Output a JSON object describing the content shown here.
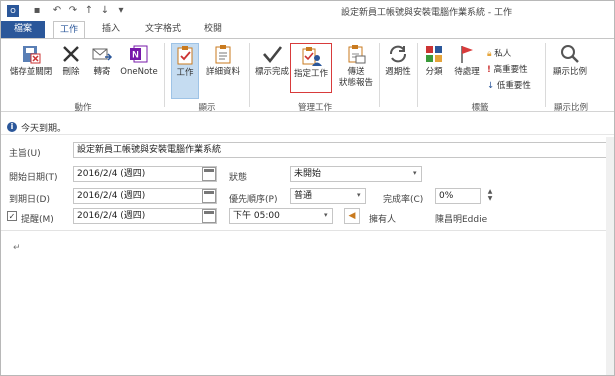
{
  "window": {
    "title": "設定新員工帳號與安裝電腦作業系統 - 工作"
  },
  "quick_access": {
    "save": "save-icon",
    "undo": "undo-icon",
    "redo": "redo-icon",
    "up": "arrow-up-icon",
    "down": "arrow-down-icon"
  },
  "tabs": [
    {
      "label": "檔案"
    },
    {
      "label": "工作"
    },
    {
      "label": "插入"
    },
    {
      "label": "文字格式"
    },
    {
      "label": "校閱"
    }
  ],
  "ribbon": {
    "groups": {
      "actions": "動作",
      "show": "顯示",
      "manage": "管理工作",
      "recurrence": "",
      "tags": "標籤",
      "zoom": "顯示比例"
    },
    "buttons": {
      "save_close": "儲存並關閉",
      "delete": "刪除",
      "forward": "轉寄",
      "onenote": "OneNote",
      "task": "工作",
      "details": "詳細資料",
      "mark_complete": "標示完成",
      "assign_task": "指定工作",
      "send_status_1": "傳送",
      "send_status_2": "狀態報告",
      "recurrence": "週期性",
      "categorize": "分類",
      "follow_up": "待處理",
      "private": "私人",
      "high_importance": "高重要性",
      "low_importance": "低重要性",
      "zoom": "顯示比例"
    }
  },
  "info": {
    "text": "今天到期。"
  },
  "form": {
    "subject_label": "主旨(U)",
    "subject_value": "設定新員工帳號與安裝電腦作業系統",
    "start_label": "開始日期(T)",
    "start_value": "2016/2/4 (週四)",
    "due_label": "到期日(D)",
    "due_value": "2016/2/4 (週四)",
    "reminder_label": "提醒(M)",
    "reminder_checked": "✓",
    "reminder_date": "2016/2/4 (週四)",
    "reminder_time": "下午 05:00",
    "status_label": "狀態",
    "status_value": "未開始",
    "priority_label": "優先順序(P)",
    "priority_value": "普通",
    "percent_label": "完成率(C)",
    "percent_value": "0%",
    "owner_label": "擁有人",
    "owner_value": "陳昌明Eddie"
  },
  "body": {
    "paragraph_mark": "↵"
  },
  "colors": {
    "brand": "#2b579a",
    "highlight": "#d0d0d0",
    "active_toggle": "#c5dcf1"
  }
}
